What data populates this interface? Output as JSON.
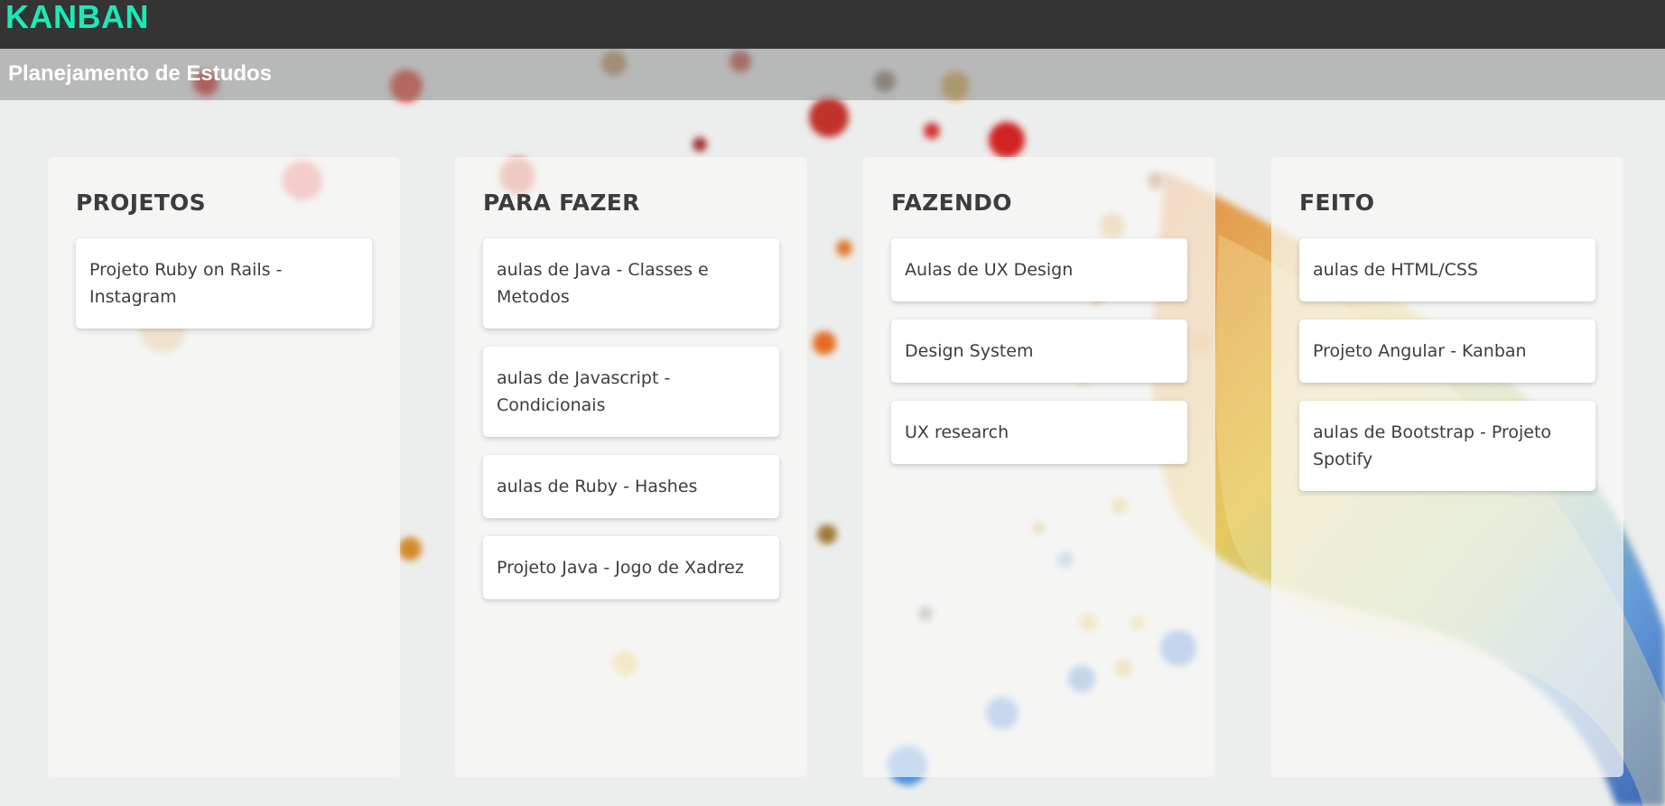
{
  "header": {
    "logo": "KANBAN",
    "board_title": "Planejamento de Estudos"
  },
  "colors": {
    "topbar": "#343434",
    "logo": "#1de9b6",
    "subbar": "#8c8c8c",
    "card_text": "#3d3d3d"
  },
  "background": {
    "description_icon": "colorful-confetti-wave"
  },
  "columns": [
    {
      "title": "PROJETOS",
      "cards": [
        "Projeto Ruby on Rails - Instagram"
      ]
    },
    {
      "title": "PARA FAZER",
      "cards": [
        "aulas de Java - Classes e Metodos",
        "aulas de Javascript - Condicionais",
        "aulas de Ruby - Hashes",
        "Projeto Java - Jogo de Xadrez"
      ]
    },
    {
      "title": "FAZENDO",
      "cards": [
        "Aulas de UX Design",
        "Design System",
        "UX research"
      ]
    },
    {
      "title": "FEITO",
      "cards": [
        "aulas de HTML/CSS",
        "Projeto Angular - Kanban",
        "aulas de Bootstrap - Projeto Spotify"
      ]
    }
  ]
}
